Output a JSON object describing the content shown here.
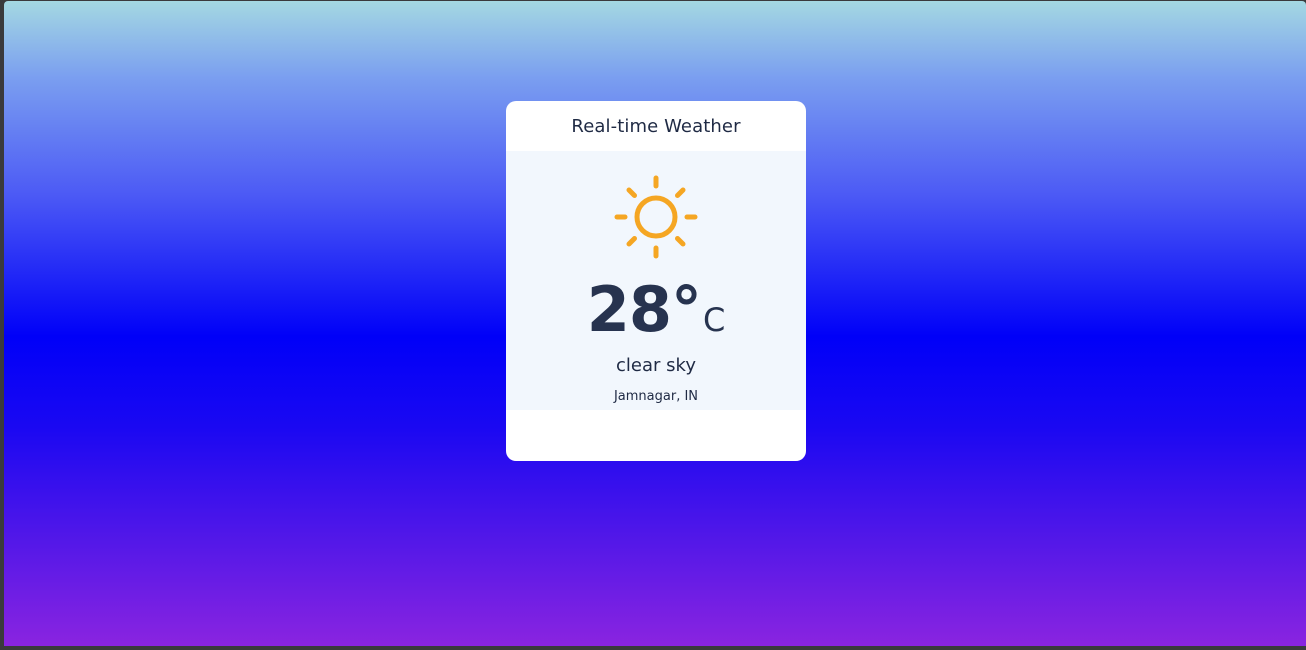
{
  "card": {
    "title": "Real-time Weather",
    "icon": "sun-icon",
    "temperature": "28°",
    "unit": "C",
    "description": "clear sky",
    "location": "Jamnagar, IN"
  },
  "colors": {
    "sun": "#f5a623",
    "text": "#1f2a44",
    "card_background": "#ffffff",
    "body_background": "#f2f7fd"
  }
}
